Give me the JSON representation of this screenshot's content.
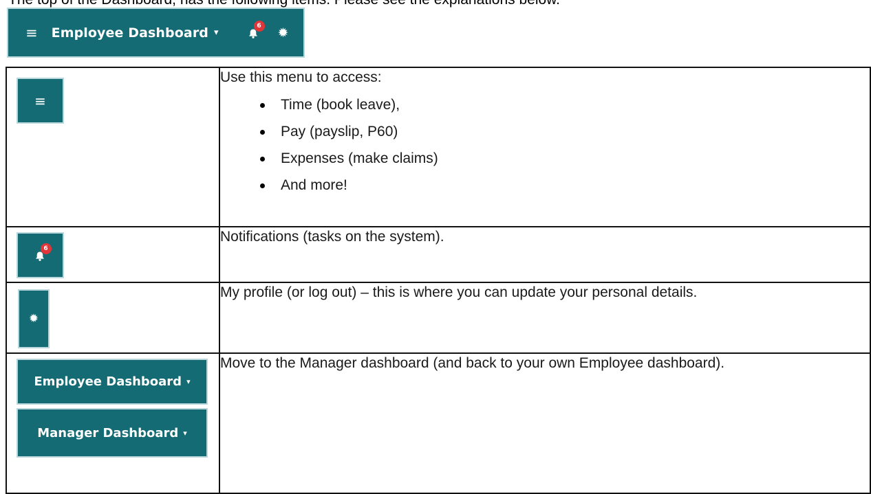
{
  "intro": {
    "text": "The top of the Dashboard, has the following items. Please see the explanations below."
  },
  "topbar": {
    "menu_icon": "hamburger-menu-icon",
    "title": "Employee Dashboard",
    "caret": "▾",
    "notification_icon": "bell-icon",
    "notification_count": "6",
    "settings_icon": "gear-icon"
  },
  "colors": {
    "teal": "#146b73",
    "badge_red": "#e0363a"
  },
  "rows": [
    {
      "icon": "hamburger-menu-icon",
      "description": "Use this menu to access:",
      "items": [
        "Time (book leave),",
        "Pay (payslip, P60)",
        "Expenses (make claims)",
        "And more!"
      ]
    },
    {
      "icon": "bell-icon",
      "badge": "6",
      "description": "Notifications (tasks on the system)."
    },
    {
      "icon": "gear-icon",
      "description": "My profile (or log out) – this is where you can update your personal details."
    },
    {
      "buttons": [
        "Employee Dashboard",
        "Manager Dashboard"
      ],
      "caret": "▾",
      "description": "Move to the Manager dashboard (and back to your own Employee dashboard)."
    }
  ]
}
